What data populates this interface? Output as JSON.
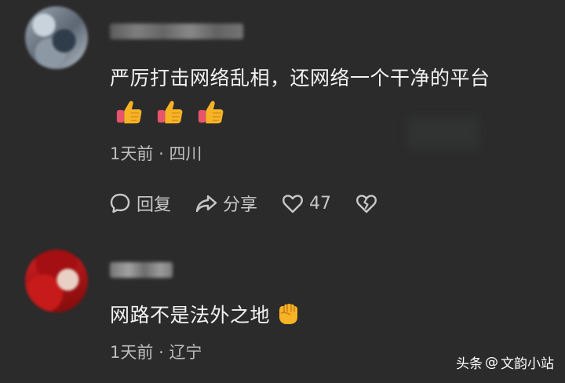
{
  "comments": [
    {
      "username": "",
      "text": "严厉打击网络乱相，还网络一个干净的平台",
      "emojis": [
        "thumbs-up",
        "thumbs-up",
        "thumbs-up"
      ],
      "time": "1天前",
      "separator": "·",
      "location": "四川",
      "reply_label": "回复",
      "share_label": "分享",
      "like_count": "47"
    },
    {
      "username": "",
      "text": "网路不是法外之地",
      "emoji": "raised-fist",
      "time": "1天前",
      "separator": "·",
      "location": "辽宁"
    }
  ],
  "watermark": {
    "brand": "头条",
    "at": "@",
    "author": "文韵小站"
  },
  "colors": {
    "background": "#2b2b2b",
    "text": "#f2f2f2",
    "meta": "#bdbdbd"
  }
}
